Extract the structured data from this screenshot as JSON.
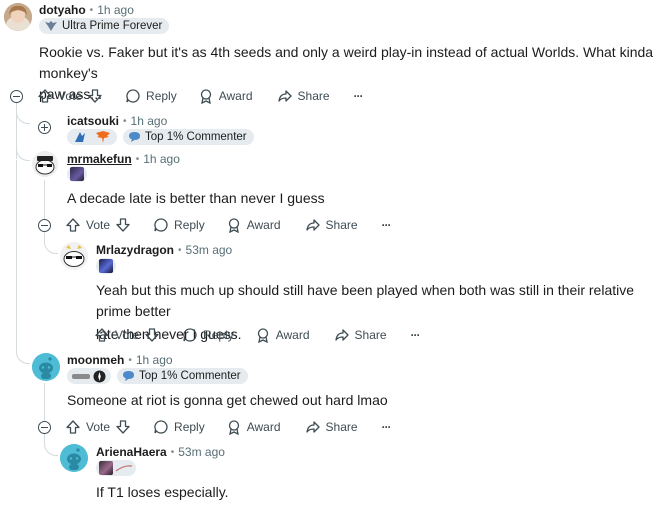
{
  "comments": [
    {
      "user": "dotyaho",
      "time": "1h ago",
      "flair": "Ultra Prime Forever",
      "text_line1": "Rookie vs. Faker but it's as 4th seeds and only a weird play-in instead of actual Worlds. What kinda monkey's",
      "text_line2": "paw ass..."
    },
    {
      "user": "icatsouki",
      "time": "1h ago",
      "flair": "Top 1% Commenter"
    },
    {
      "user": "mrmakefun",
      "time": "1h ago",
      "text": "A decade late is better than never I guess"
    },
    {
      "user": "Mrlazydragon",
      "time": "53m ago",
      "text_line1": "Yeah but this much up should still have been played when both was still in their relative prime better",
      "text_line2": "late then never I guess."
    },
    {
      "user": "moonmeh",
      "time": "1h ago",
      "flair": "Top 1% Commenter",
      "text": "Someone at riot is gonna get chewed out hard lmao"
    },
    {
      "user": "ArienaHaera",
      "time": "53m ago",
      "text": "If T1 loses especially."
    }
  ],
  "actions": {
    "vote": "Vote",
    "reply": "Reply",
    "award": "Award",
    "share": "Share",
    "more": "···"
  },
  "meta_separator": "•",
  "colors": {
    "thread_line": "#d5dadd",
    "flair_bg": "#e5ebee",
    "avatar_blue": "#4fbcd6",
    "meta_gray": "#576f76"
  },
  "icons": [
    "upvote-icon",
    "downvote-icon",
    "reply-bubble-icon",
    "award-icon",
    "share-icon",
    "more-icon",
    "collapse-icon",
    "expand-icon",
    "snoo-avatar-icon"
  ]
}
